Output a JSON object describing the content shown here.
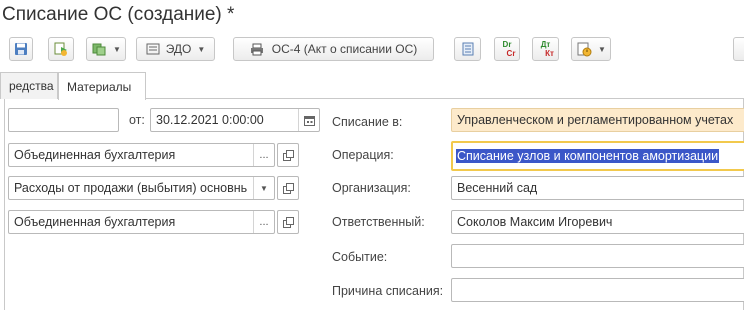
{
  "window": {
    "title": "Списание ОС (создание) *"
  },
  "toolbar": {
    "edo_label": "ЭДО",
    "os4_label": "ОС-4 (Акт о списании ОС)",
    "dt_label": "Dr",
    "cr_label": "Cr",
    "dt2_label": "Дт",
    "kt_label": "Кт"
  },
  "tabs": [
    {
      "label": "редства"
    },
    {
      "label": "Материалы"
    }
  ],
  "left": {
    "number_value": "",
    "date_from_label": "от:",
    "date_value": "30.12.2021  0:00:00",
    "field1_value": "Объединенная бухгалтерия",
    "field2_value": "Расходы от продажи (выбытия) основнь",
    "field3_value": "Объединенная бухгалтерия",
    "ellipsis": "..."
  },
  "right": {
    "writeoff_label": "Списание в:",
    "writeoff_value": "Управленческом и регламентированном учетах",
    "operation_label": "Операция:",
    "operation_value": "Списание узлов и компонентов амортизации",
    "org_label": "Организация:",
    "org_value": "Весенний сад",
    "resp_label": "Ответственный:",
    "resp_value": "Соколов Максим Игоревич",
    "event_label": "Событие:",
    "event_value": "",
    "reason_label": "Причина списания:",
    "reason_value": ""
  },
  "colors": {
    "writeoff_bg": "#fdeacb",
    "operation_border": "#f2c94c",
    "selection": "#3b57c8"
  }
}
